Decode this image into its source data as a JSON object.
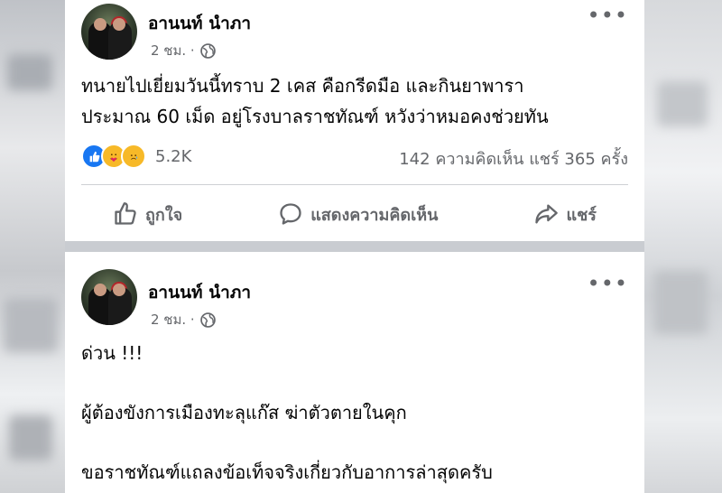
{
  "posts": [
    {
      "author": "อานนท์ นำภา",
      "time": "2 ชม. ·",
      "privacy_icon": "globe-icon",
      "text": "ทนายไปเยี่ยมวันนี้ทราบ 2 เคส คือกรีดมือ และกินยาพารา\nประมาณ 60 เม็ด อยู่โรงบาลราชทัณฑ์ หวังว่าหมอคงช่วยทัน",
      "reactions": {
        "icons": [
          "like-icon",
          "care-icon",
          "sad-icon"
        ],
        "count": "5.2K"
      },
      "stats": "142 ความคิดเห็น  แชร์ 365 ครั้ง",
      "actions": {
        "like": "ถูกใจ",
        "comment": "แสดงความคิดเห็น",
        "share": "แชร์"
      }
    },
    {
      "author": "อานนท์ นำภา",
      "time": "2 ชม. ·",
      "privacy_icon": "globe-icon",
      "text": "ด่วน !!!\n\nผู้ต้องขังการเมืองทะลุแก๊ส ฆ่าตัวตายในคุก\n\nขอราชทัณฑ์แถลงข้อเท็จจริงเกี่ยวกับอาการล่าสุดครับ"
    }
  ],
  "colors": {
    "accent": "#1877f2",
    "secondary_text": "#65676b",
    "divider": "#ced0d4"
  }
}
